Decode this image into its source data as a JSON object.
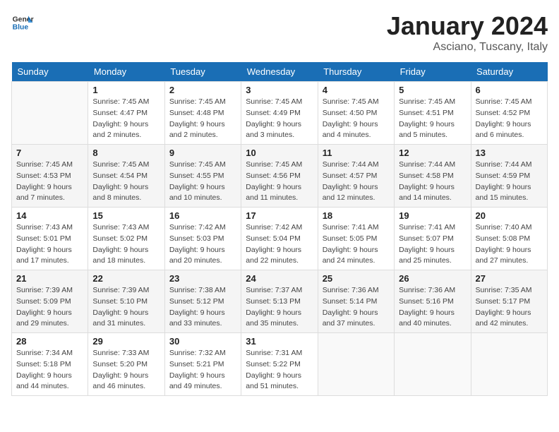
{
  "header": {
    "logo_general": "General",
    "logo_blue": "Blue",
    "month_title": "January 2024",
    "location": "Asciano, Tuscany, Italy"
  },
  "weekdays": [
    "Sunday",
    "Monday",
    "Tuesday",
    "Wednesday",
    "Thursday",
    "Friday",
    "Saturday"
  ],
  "weeks": [
    [
      {
        "day": "",
        "sunrise": "",
        "sunset": "",
        "daylight": ""
      },
      {
        "day": "1",
        "sunrise": "Sunrise: 7:45 AM",
        "sunset": "Sunset: 4:47 PM",
        "daylight": "Daylight: 9 hours and 2 minutes."
      },
      {
        "day": "2",
        "sunrise": "Sunrise: 7:45 AM",
        "sunset": "Sunset: 4:48 PM",
        "daylight": "Daylight: 9 hours and 2 minutes."
      },
      {
        "day": "3",
        "sunrise": "Sunrise: 7:45 AM",
        "sunset": "Sunset: 4:49 PM",
        "daylight": "Daylight: 9 hours and 3 minutes."
      },
      {
        "day": "4",
        "sunrise": "Sunrise: 7:45 AM",
        "sunset": "Sunset: 4:50 PM",
        "daylight": "Daylight: 9 hours and 4 minutes."
      },
      {
        "day": "5",
        "sunrise": "Sunrise: 7:45 AM",
        "sunset": "Sunset: 4:51 PM",
        "daylight": "Daylight: 9 hours and 5 minutes."
      },
      {
        "day": "6",
        "sunrise": "Sunrise: 7:45 AM",
        "sunset": "Sunset: 4:52 PM",
        "daylight": "Daylight: 9 hours and 6 minutes."
      }
    ],
    [
      {
        "day": "7",
        "sunrise": "Sunrise: 7:45 AM",
        "sunset": "Sunset: 4:53 PM",
        "daylight": "Daylight: 9 hours and 7 minutes."
      },
      {
        "day": "8",
        "sunrise": "Sunrise: 7:45 AM",
        "sunset": "Sunset: 4:54 PM",
        "daylight": "Daylight: 9 hours and 8 minutes."
      },
      {
        "day": "9",
        "sunrise": "Sunrise: 7:45 AM",
        "sunset": "Sunset: 4:55 PM",
        "daylight": "Daylight: 9 hours and 10 minutes."
      },
      {
        "day": "10",
        "sunrise": "Sunrise: 7:45 AM",
        "sunset": "Sunset: 4:56 PM",
        "daylight": "Daylight: 9 hours and 11 minutes."
      },
      {
        "day": "11",
        "sunrise": "Sunrise: 7:44 AM",
        "sunset": "Sunset: 4:57 PM",
        "daylight": "Daylight: 9 hours and 12 minutes."
      },
      {
        "day": "12",
        "sunrise": "Sunrise: 7:44 AM",
        "sunset": "Sunset: 4:58 PM",
        "daylight": "Daylight: 9 hours and 14 minutes."
      },
      {
        "day": "13",
        "sunrise": "Sunrise: 7:44 AM",
        "sunset": "Sunset: 4:59 PM",
        "daylight": "Daylight: 9 hours and 15 minutes."
      }
    ],
    [
      {
        "day": "14",
        "sunrise": "Sunrise: 7:43 AM",
        "sunset": "Sunset: 5:01 PM",
        "daylight": "Daylight: 9 hours and 17 minutes."
      },
      {
        "day": "15",
        "sunrise": "Sunrise: 7:43 AM",
        "sunset": "Sunset: 5:02 PM",
        "daylight": "Daylight: 9 hours and 18 minutes."
      },
      {
        "day": "16",
        "sunrise": "Sunrise: 7:42 AM",
        "sunset": "Sunset: 5:03 PM",
        "daylight": "Daylight: 9 hours and 20 minutes."
      },
      {
        "day": "17",
        "sunrise": "Sunrise: 7:42 AM",
        "sunset": "Sunset: 5:04 PM",
        "daylight": "Daylight: 9 hours and 22 minutes."
      },
      {
        "day": "18",
        "sunrise": "Sunrise: 7:41 AM",
        "sunset": "Sunset: 5:05 PM",
        "daylight": "Daylight: 9 hours and 24 minutes."
      },
      {
        "day": "19",
        "sunrise": "Sunrise: 7:41 AM",
        "sunset": "Sunset: 5:07 PM",
        "daylight": "Daylight: 9 hours and 25 minutes."
      },
      {
        "day": "20",
        "sunrise": "Sunrise: 7:40 AM",
        "sunset": "Sunset: 5:08 PM",
        "daylight": "Daylight: 9 hours and 27 minutes."
      }
    ],
    [
      {
        "day": "21",
        "sunrise": "Sunrise: 7:39 AM",
        "sunset": "Sunset: 5:09 PM",
        "daylight": "Daylight: 9 hours and 29 minutes."
      },
      {
        "day": "22",
        "sunrise": "Sunrise: 7:39 AM",
        "sunset": "Sunset: 5:10 PM",
        "daylight": "Daylight: 9 hours and 31 minutes."
      },
      {
        "day": "23",
        "sunrise": "Sunrise: 7:38 AM",
        "sunset": "Sunset: 5:12 PM",
        "daylight": "Daylight: 9 hours and 33 minutes."
      },
      {
        "day": "24",
        "sunrise": "Sunrise: 7:37 AM",
        "sunset": "Sunset: 5:13 PM",
        "daylight": "Daylight: 9 hours and 35 minutes."
      },
      {
        "day": "25",
        "sunrise": "Sunrise: 7:36 AM",
        "sunset": "Sunset: 5:14 PM",
        "daylight": "Daylight: 9 hours and 37 minutes."
      },
      {
        "day": "26",
        "sunrise": "Sunrise: 7:36 AM",
        "sunset": "Sunset: 5:16 PM",
        "daylight": "Daylight: 9 hours and 40 minutes."
      },
      {
        "day": "27",
        "sunrise": "Sunrise: 7:35 AM",
        "sunset": "Sunset: 5:17 PM",
        "daylight": "Daylight: 9 hours and 42 minutes."
      }
    ],
    [
      {
        "day": "28",
        "sunrise": "Sunrise: 7:34 AM",
        "sunset": "Sunset: 5:18 PM",
        "daylight": "Daylight: 9 hours and 44 minutes."
      },
      {
        "day": "29",
        "sunrise": "Sunrise: 7:33 AM",
        "sunset": "Sunset: 5:20 PM",
        "daylight": "Daylight: 9 hours and 46 minutes."
      },
      {
        "day": "30",
        "sunrise": "Sunrise: 7:32 AM",
        "sunset": "Sunset: 5:21 PM",
        "daylight": "Daylight: 9 hours and 49 minutes."
      },
      {
        "day": "31",
        "sunrise": "Sunrise: 7:31 AM",
        "sunset": "Sunset: 5:22 PM",
        "daylight": "Daylight: 9 hours and 51 minutes."
      },
      {
        "day": "",
        "sunrise": "",
        "sunset": "",
        "daylight": ""
      },
      {
        "day": "",
        "sunrise": "",
        "sunset": "",
        "daylight": ""
      },
      {
        "day": "",
        "sunrise": "",
        "sunset": "",
        "daylight": ""
      }
    ]
  ]
}
